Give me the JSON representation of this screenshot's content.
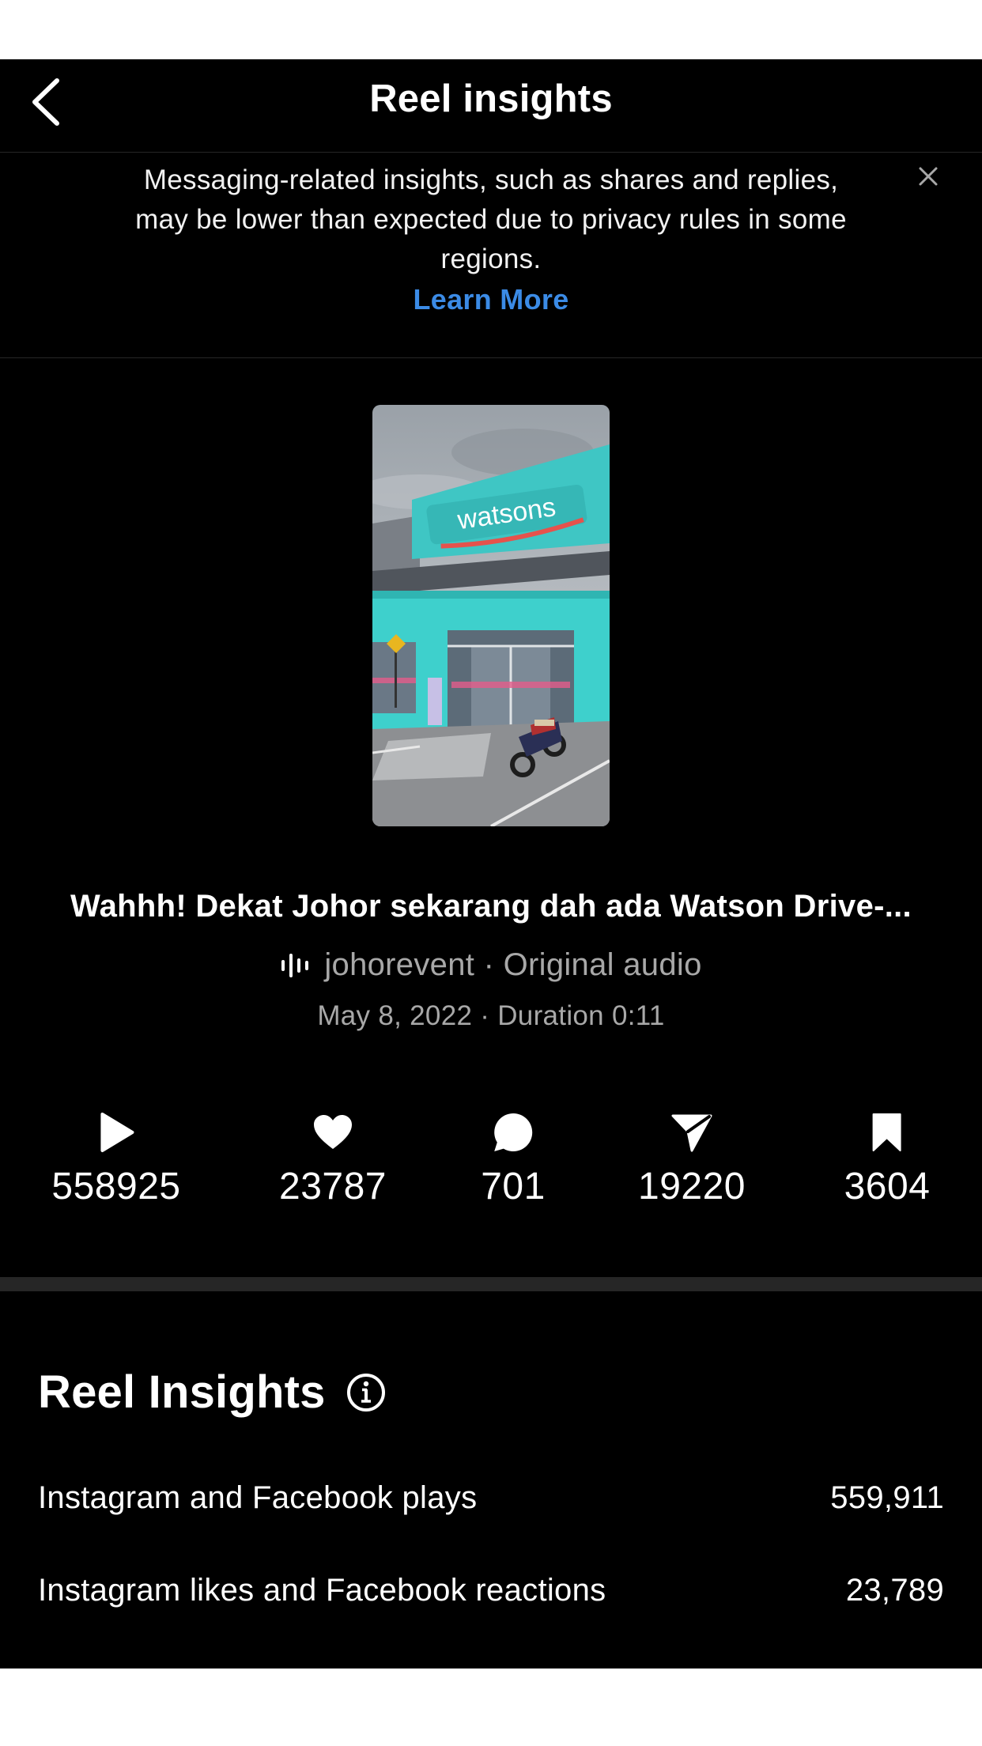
{
  "header": {
    "title": "Reel insights",
    "back_icon": "chevron-left-icon"
  },
  "notice": {
    "lines": [
      "Messaging-related insights, such as shares and replies,",
      "may be lower than expected due to privacy rules in some",
      "regions."
    ],
    "link": "Learn More",
    "link_color": "#3b8be6",
    "close_icon": "close-icon"
  },
  "reel": {
    "thumbnail_sign": "watsons",
    "caption": "Wahhh! Dekat Johor sekarang dah ada Watson Drive-...",
    "audio_icon": "audio-wave-icon",
    "audio": "johorevent · Original audio",
    "meta": "May 8, 2022 · Duration 0:11"
  },
  "stats": [
    {
      "icon": "play-icon",
      "value": "558925"
    },
    {
      "icon": "heart-icon",
      "value": "23787"
    },
    {
      "icon": "comment-icon",
      "value": "701"
    },
    {
      "icon": "share-icon",
      "value": "19220"
    },
    {
      "icon": "bookmark-icon",
      "value": "3604"
    }
  ],
  "insights": {
    "heading": "Reel Insights",
    "info_icon": "info-icon",
    "rows": [
      {
        "label": "Instagram and Facebook plays",
        "value": "559,911"
      },
      {
        "label": "Instagram likes and Facebook reactions",
        "value": "23,789"
      }
    ]
  }
}
